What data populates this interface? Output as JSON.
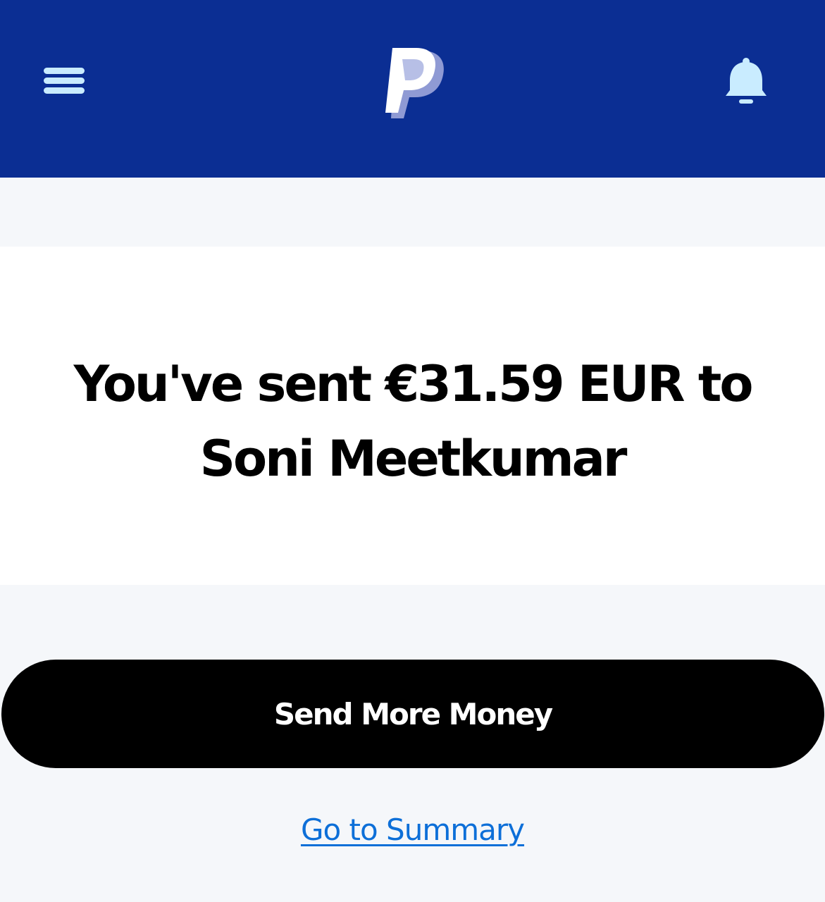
{
  "header": {
    "menu_icon": "hamburger-menu-icon",
    "logo_icon": "paypal-logo",
    "notifications_icon": "bell-icon",
    "background_color": "#0b2e93",
    "icon_color": "#c9ecff"
  },
  "confirmation": {
    "message": "You've sent €31.59 EUR to Soni Meetkumar"
  },
  "actions": {
    "send_more_label": "Send More Money",
    "summary_link_label": "Go to Summary",
    "link_color": "#0d6fd8"
  }
}
